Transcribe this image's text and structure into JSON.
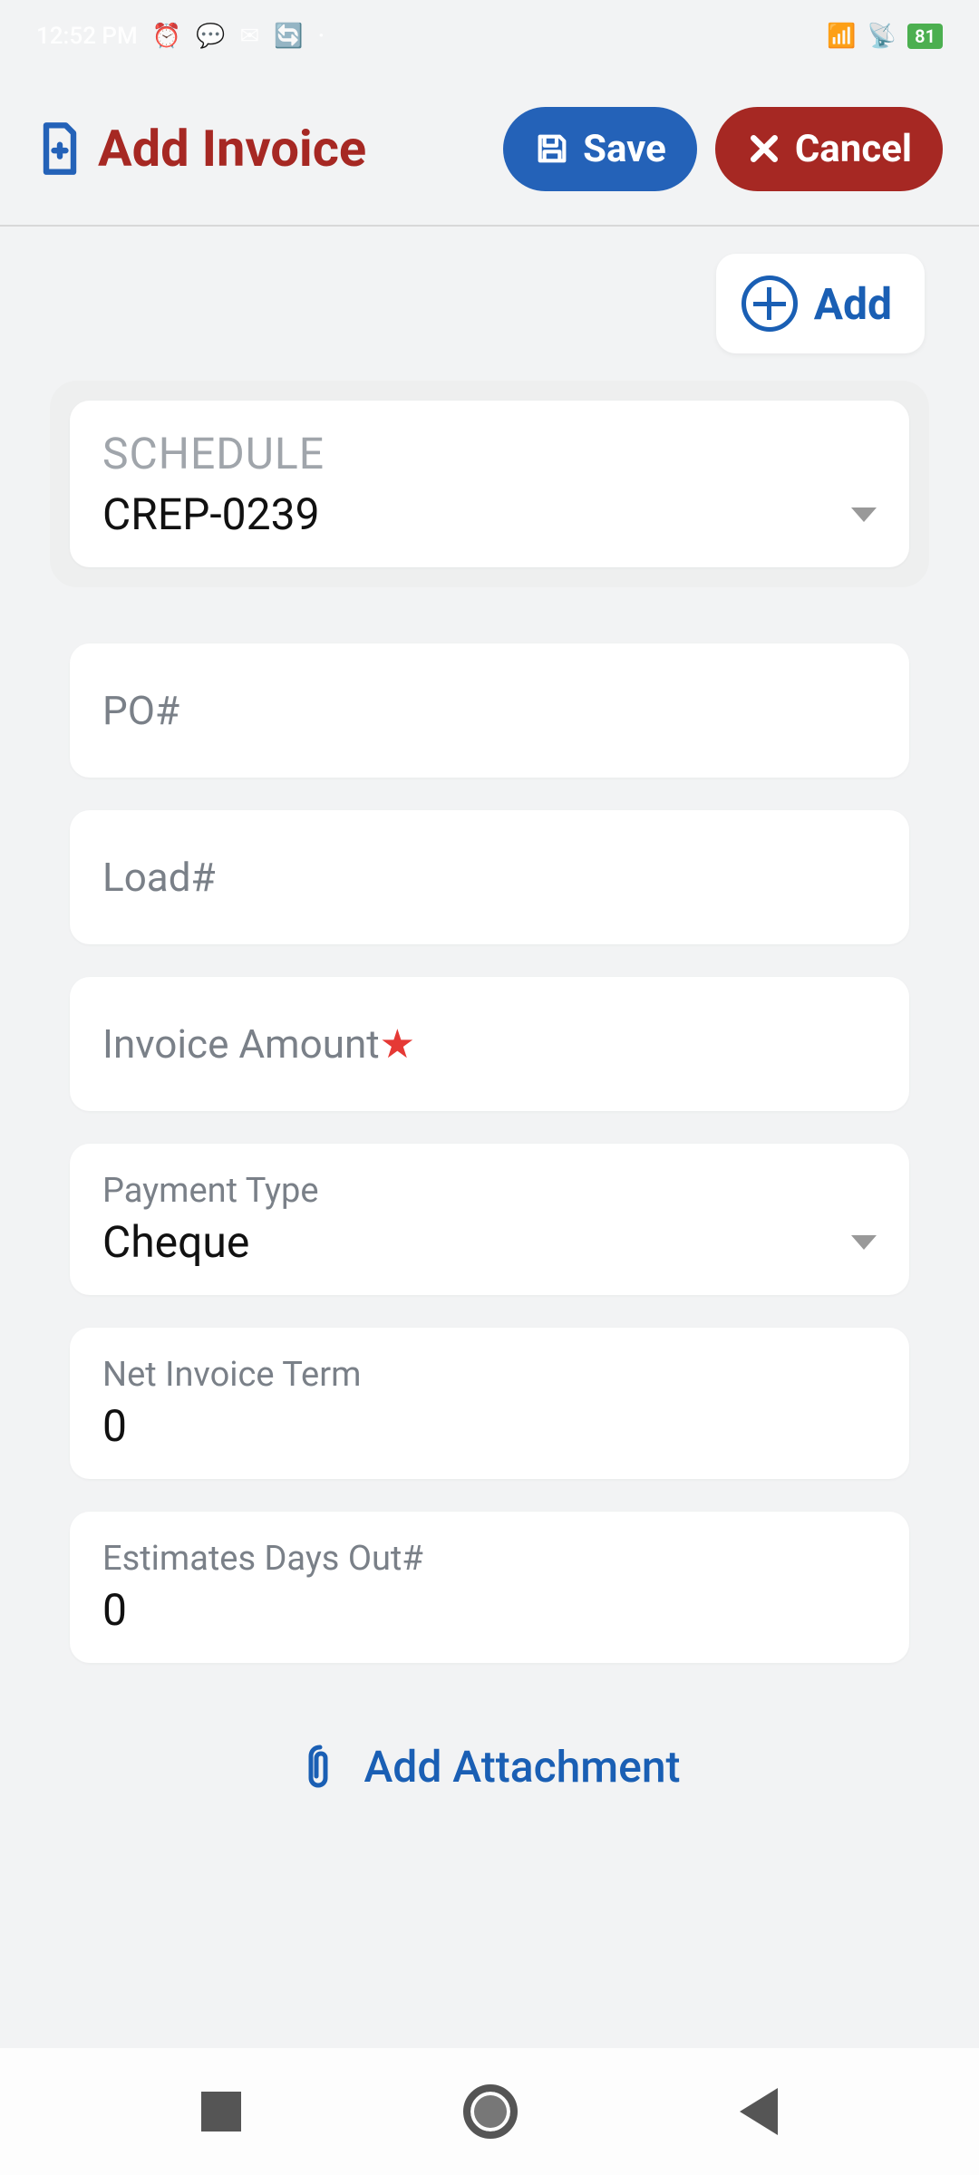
{
  "status": {
    "time": "12:52 PM",
    "battery": "81"
  },
  "header": {
    "title": "Add Invoice",
    "save_label": "Save",
    "cancel_label": "Cancel",
    "add_label": "Add"
  },
  "schedule": {
    "label": "SCHEDULE",
    "value": "CREP-0239"
  },
  "fields": {
    "po_placeholder": "PO#",
    "load_placeholder": "Load#",
    "invoice_amount_placeholder": "Invoice Amount",
    "payment_type_label": "Payment Type",
    "payment_type_value": "Cheque",
    "net_invoice_term_label": "Net Invoice Term",
    "net_invoice_term_value": "0",
    "estimates_days_out_label": "Estimates Days Out#",
    "estimates_days_out_value": "0"
  },
  "attachment": {
    "label": "Add Attachment"
  }
}
